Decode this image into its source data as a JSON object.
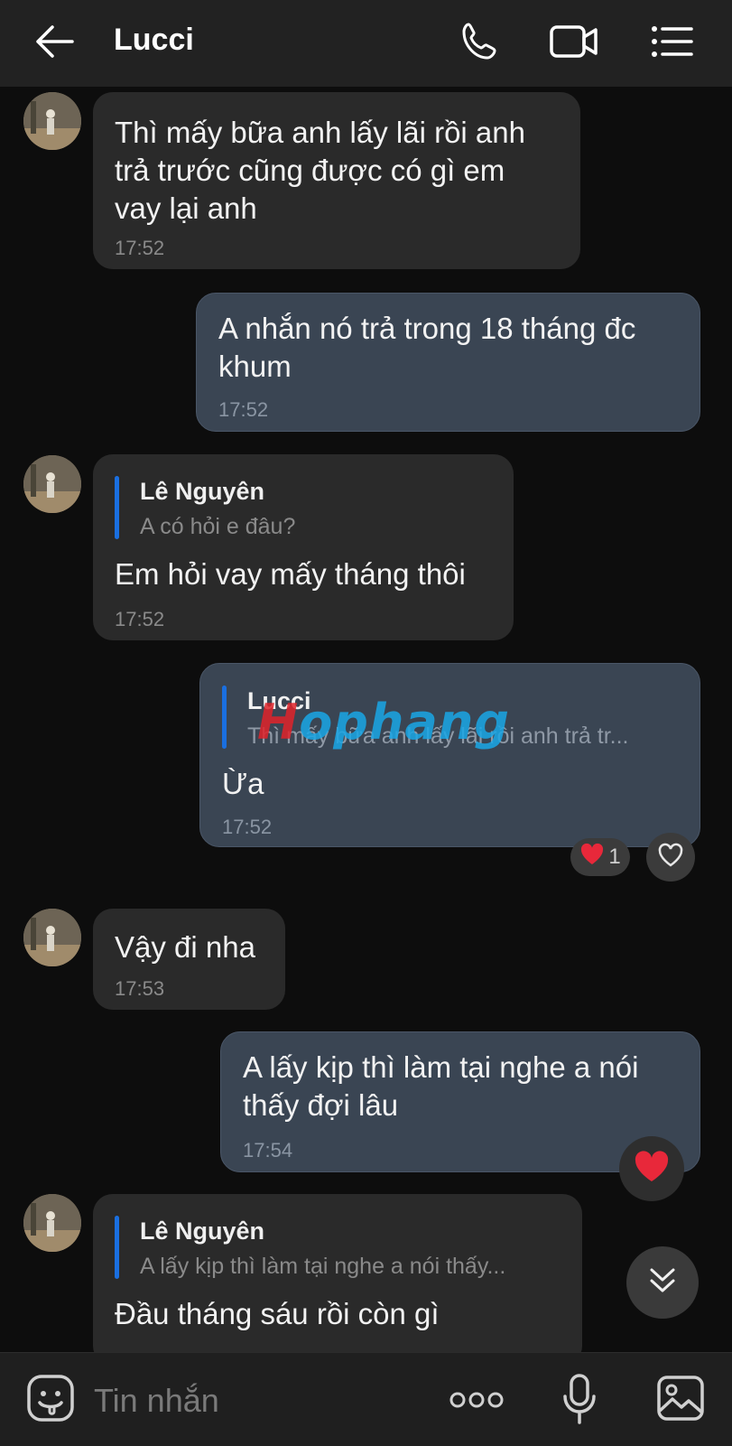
{
  "header": {
    "title": "Lucci"
  },
  "messages": [
    {
      "id": "m1",
      "text": "Thì mấy bữa anh lấy lãi rồi anh trả trước cũng được có gì em vay lại anh",
      "lines": [
        "Thì mấy bữa anh lấy lãi rồi anh",
        "trả trước cũng được có gì em",
        "vay lại anh"
      ],
      "time": "17:52"
    },
    {
      "id": "m2",
      "lines": [
        "A nhắn nó trả trong 18 tháng đc",
        "khum"
      ],
      "time": "17:52"
    },
    {
      "id": "m3",
      "quote_name": "Lê Nguyên",
      "quote_text": "A có hỏi e đâu?",
      "text": "Em hỏi vay mấy tháng thôi",
      "time": "17:52"
    },
    {
      "id": "m4",
      "quote_name": "Lucci",
      "quote_text": "Thì mấy bữa anh lấy lãi rồi anh trả tr...",
      "text": "Ừa",
      "time": "17:52",
      "reaction_count": "1"
    },
    {
      "id": "m5",
      "text": "Vậy đi nha",
      "time": "17:53"
    },
    {
      "id": "m6",
      "lines": [
        "A lấy kịp thì làm tại nghe a nói",
        "thấy đợi lâu"
      ],
      "time": "17:54"
    },
    {
      "id": "m7",
      "quote_name": "Lê Nguyên",
      "quote_text": "A lấy kịp thì làm tại nghe a nói thấy...",
      "text": "Đầu tháng sáu rồi còn gì"
    }
  ],
  "input": {
    "placeholder": "Tin nhắn"
  },
  "watermark": {
    "first": "H",
    "rest": "ophang"
  },
  "colors": {
    "accent": "#1a6fe0",
    "heart": "#e8283a"
  },
  "icons": [
    "back-arrow-icon",
    "phone-icon",
    "video-call-icon",
    "menu-list-icon",
    "heart-icon",
    "chevron-double-down-icon",
    "sticker-icon",
    "more-dots-icon",
    "microphone-icon",
    "image-icon"
  ]
}
